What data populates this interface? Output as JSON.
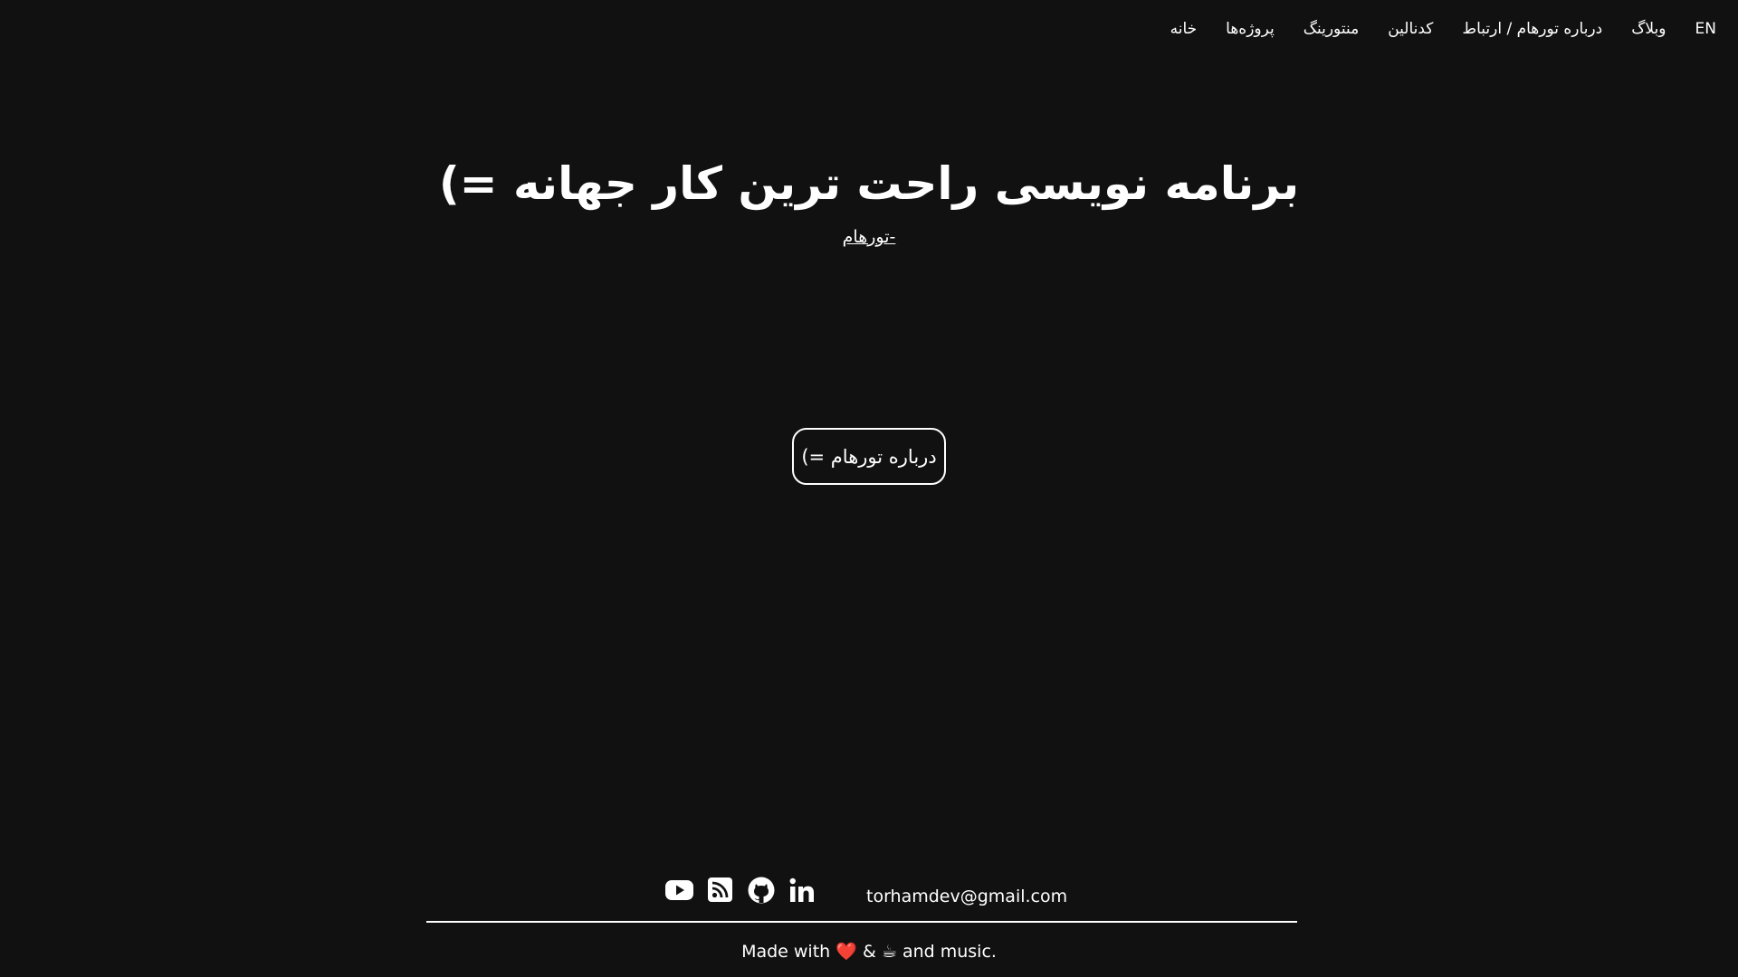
{
  "nav": {
    "items": [
      {
        "label": "خانه"
      },
      {
        "label": "پروژه‌ها"
      },
      {
        "label": "منتورینگ"
      },
      {
        "label": "کدنالین"
      },
      {
        "label": "درباره تورهام / ارتباط"
      },
      {
        "label": "وبلاگ"
      },
      {
        "label": "EN"
      }
    ]
  },
  "hero": {
    "title": "برنامه نویسی راحت ترین کار جهانه =)",
    "signature": "-تورهام"
  },
  "about_button": {
    "label": "درباره تورهام =)"
  },
  "footer": {
    "social_icons": [
      "youtube-icon",
      "rss-icon",
      "github-icon",
      "linkedin-icon"
    ],
    "email": "torhamdev@gmail.com",
    "made_with_prefix": "Made with",
    "heart": "❤️",
    "ampersand": "&",
    "coffee": "☕",
    "made_with_suffix": "and music."
  },
  "colors": {
    "background": "#111111",
    "text": "#ffffff",
    "heart": "#e5243b"
  }
}
